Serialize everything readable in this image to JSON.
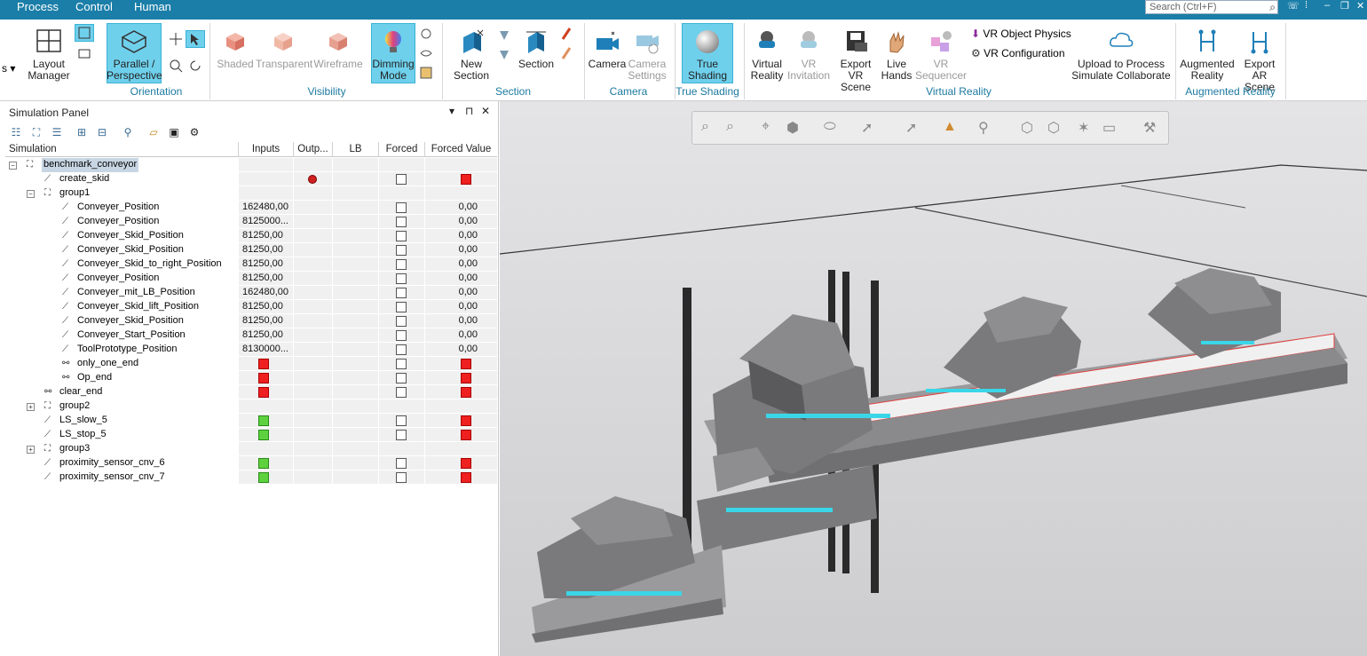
{
  "menu": {
    "process": "Process",
    "control": "Control",
    "human": "Human"
  },
  "search": {
    "placeholder": "Search (Ctrl+F)"
  },
  "ribbon": {
    "layout_manager": "Layout\nManager",
    "parallel_perspective": "Parallel /\nPerspective",
    "orientation": "Orientation",
    "shaded": "Shaded",
    "transparent": "Transparent",
    "wireframe": "Wireframe",
    "dimming_mode": "Dimming\nMode",
    "visibility": "Visibility",
    "new_section": "New\nSection",
    "section_btn": "Section",
    "section_group": "Section",
    "camera": "Camera",
    "camera_settings": "Camera\nSettings",
    "camera_group": "Camera",
    "true_shading": "True\nShading",
    "true_shading_group": "True Shading",
    "virtual_reality": "Virtual\nReality",
    "vr_invitation": "VR\nInvitation",
    "export_vr_scene": "Export\nVR Scene",
    "live_hands": "Live\nHands",
    "vr_sequencer": "VR\nSequencer",
    "vr_object_physics": "VR Object Physics",
    "vr_configuration": "VR Configuration",
    "upload": "Upload to Process\nSimulate Collaborate",
    "vr_group": "Virtual Reality",
    "augmented_reality": "Augmented\nReality",
    "export_ar_scene": "Export\nAR Scene",
    "ar_group": "Augmented Reality"
  },
  "panel": {
    "title": "Simulation Panel",
    "columns": [
      "Simulation",
      "Inputs",
      "Outp...",
      "LB",
      "Forced",
      "Forced Value"
    ],
    "rows": [
      {
        "name": "benchmark_conveyor",
        "level": 0,
        "tree": "minus",
        "icon": "group",
        "selected": true
      },
      {
        "name": "create_skid",
        "level": 1,
        "icon": "op",
        "output": "led",
        "forced": true,
        "forced_value": "red"
      },
      {
        "name": "group1",
        "level": 1,
        "tree": "minus",
        "icon": "group"
      },
      {
        "name": "Conveyer_Position",
        "level": 2,
        "icon": "op",
        "input": "162480,00",
        "forced": true,
        "forced_value": "0,00"
      },
      {
        "name": "Conveyer_Position",
        "level": 2,
        "icon": "op",
        "input": "8125000...",
        "forced": true,
        "forced_value": "0,00"
      },
      {
        "name": "Conveyer_Skid_Position",
        "level": 2,
        "icon": "op",
        "input": "81250,00",
        "forced": true,
        "forced_value": "0,00"
      },
      {
        "name": "Conveyer_Skid_Position",
        "level": 2,
        "icon": "op",
        "input": "81250,00",
        "forced": true,
        "forced_value": "0,00"
      },
      {
        "name": "Conveyer_Skid_to_right_Position",
        "level": 2,
        "icon": "op",
        "input": "81250,00",
        "forced": true,
        "forced_value": "0,00"
      },
      {
        "name": "Conveyer_Position",
        "level": 2,
        "icon": "op",
        "input": "81250,00",
        "forced": true,
        "forced_value": "0,00"
      },
      {
        "name": "Conveyer_mit_LB_Position",
        "level": 2,
        "icon": "op",
        "input": "162480,00",
        "forced": true,
        "forced_value": "0,00"
      },
      {
        "name": "Conveyer_Skid_lift_Position",
        "level": 2,
        "icon": "op",
        "input": "81250,00",
        "forced": true,
        "forced_value": "0,00"
      },
      {
        "name": "Conveyer_Skid_Position",
        "level": 2,
        "icon": "op",
        "input": "81250,00",
        "forced": true,
        "forced_value": "0,00"
      },
      {
        "name": "Conveyer_Start_Position",
        "level": 2,
        "icon": "op",
        "input": "81250,00",
        "forced": true,
        "forced_value": "0,00"
      },
      {
        "name": "ToolPrototype_Position",
        "level": 2,
        "icon": "op",
        "input": "8130000...",
        "forced": false,
        "forced_value": "0,00"
      },
      {
        "name": "only_one_end",
        "level": 2,
        "icon": "nonsim",
        "input": "red",
        "forced": true,
        "forced_value": "red"
      },
      {
        "name": "Op_end",
        "level": 2,
        "icon": "nonsim",
        "input": "red",
        "forced": true,
        "forced_value": "red"
      },
      {
        "name": "clear_end",
        "level": 1,
        "icon": "nonsim",
        "input": "red",
        "forced": true,
        "forced_value": "red"
      },
      {
        "name": "group2",
        "level": 1,
        "tree": "plus",
        "icon": "group"
      },
      {
        "name": "LS_slow_5",
        "level": 1,
        "icon": "op",
        "input": "green",
        "forced": true,
        "forced_value": "red"
      },
      {
        "name": "LS_stop_5",
        "level": 1,
        "icon": "op",
        "input": "green",
        "forced": true,
        "forced_value": "red"
      },
      {
        "name": "group3",
        "level": 1,
        "tree": "plus",
        "icon": "group"
      },
      {
        "name": "proximity_sensor_cnv_6",
        "level": 1,
        "icon": "op",
        "input": "green",
        "forced": true,
        "forced_value": "red"
      },
      {
        "name": "proximity_sensor_cnv_7",
        "level": 1,
        "icon": "op",
        "input": "green",
        "forced": true,
        "forced_value": "red"
      }
    ]
  },
  "colors": {
    "accent": "#1a7ea8",
    "highlight": "#6fd0ec",
    "status_red": "#ee2020",
    "status_green": "#5ed23e"
  }
}
